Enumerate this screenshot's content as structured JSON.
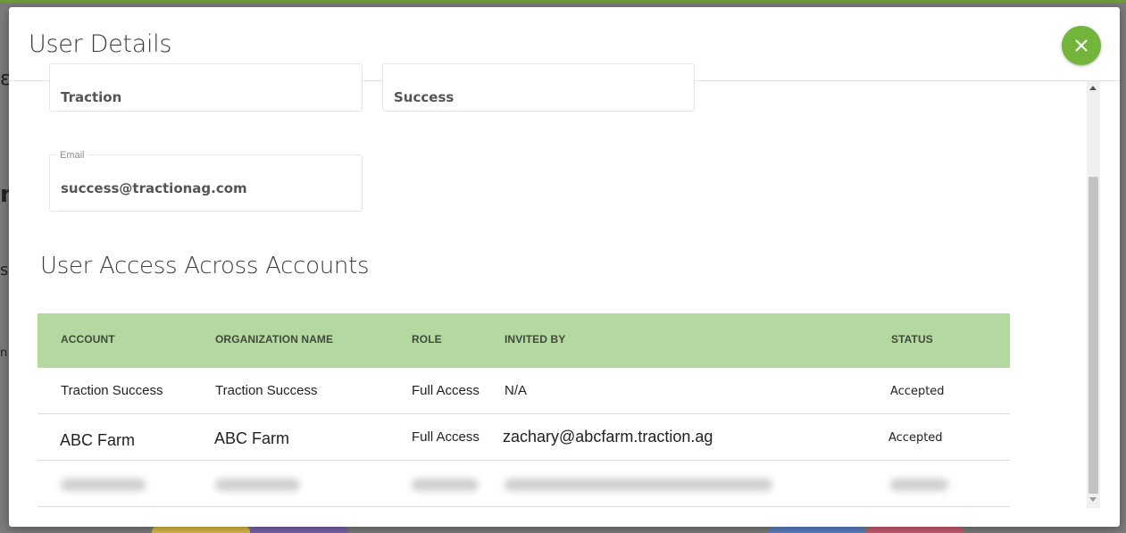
{
  "modal": {
    "title": "User Details",
    "close_icon": "close-icon"
  },
  "form": {
    "first_name_value": "Traction",
    "last_name_value": "Success",
    "email_label": "Email",
    "email_value": "success@tractionag.com"
  },
  "access_section": {
    "title": "User Access Across Accounts",
    "columns": [
      "ACCOUNT",
      "ORGANIZATION NAME",
      "ROLE",
      "INVITED BY",
      "STATUS"
    ],
    "rows": [
      {
        "account": "Traction Success",
        "organization": "Traction Success",
        "role": "Full Access",
        "invited_by": "N/A",
        "status": "Accepted"
      },
      {
        "account": "ABC Farm",
        "organization": "ABC Farm",
        "role": "Full Access",
        "invited_by": "zachary@abcfarm.traction.ag",
        "status": "Accepted"
      }
    ]
  },
  "colors": {
    "accent_green": "#72b53a",
    "table_header_bg": "#b5d7a0"
  }
}
